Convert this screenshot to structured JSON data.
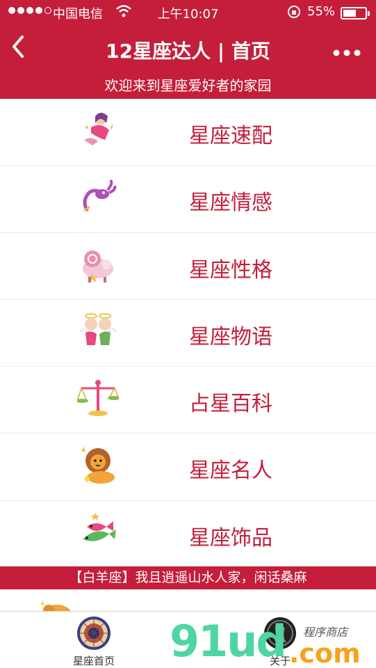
{
  "status_bar": {
    "carrier": "中国电信",
    "time": "上午10:07",
    "battery": "55%"
  },
  "nav": {
    "back_icon": "chevron-left-icon",
    "title": "12星座达人 | 首页",
    "more_icon": "more-dots-icon"
  },
  "welcome": "欢迎来到星座爱好者的家园",
  "menu": [
    {
      "label": "星座速配",
      "icon": "virgo-fairy-icon"
    },
    {
      "label": "星座情感",
      "icon": "scorpion-icon"
    },
    {
      "label": "星座性格",
      "icon": "ram-icon"
    },
    {
      "label": "星座物语",
      "icon": "gemini-twins-icon"
    },
    {
      "label": "占星百科",
      "icon": "libra-scales-icon"
    },
    {
      "label": "星座名人",
      "icon": "lion-icon"
    },
    {
      "label": "星座饰品",
      "icon": "fish-icon"
    }
  ],
  "quote": "【白羊座】我且逍遥山水人家，闲话桑麻",
  "tabs": [
    {
      "label": "星座首页",
      "icon": "zodiac-wheel-icon"
    },
    {
      "label": "关于",
      "icon": "about-icon"
    }
  ],
  "watermark": {
    "brand": "91ud",
    "domain": ".com",
    "shop": "程序商店"
  },
  "colors": {
    "primary": "#c41e3a",
    "label": "#c41e3a",
    "watermark_green": "#4ed6a0",
    "watermark_orange": "#f6a21d"
  }
}
